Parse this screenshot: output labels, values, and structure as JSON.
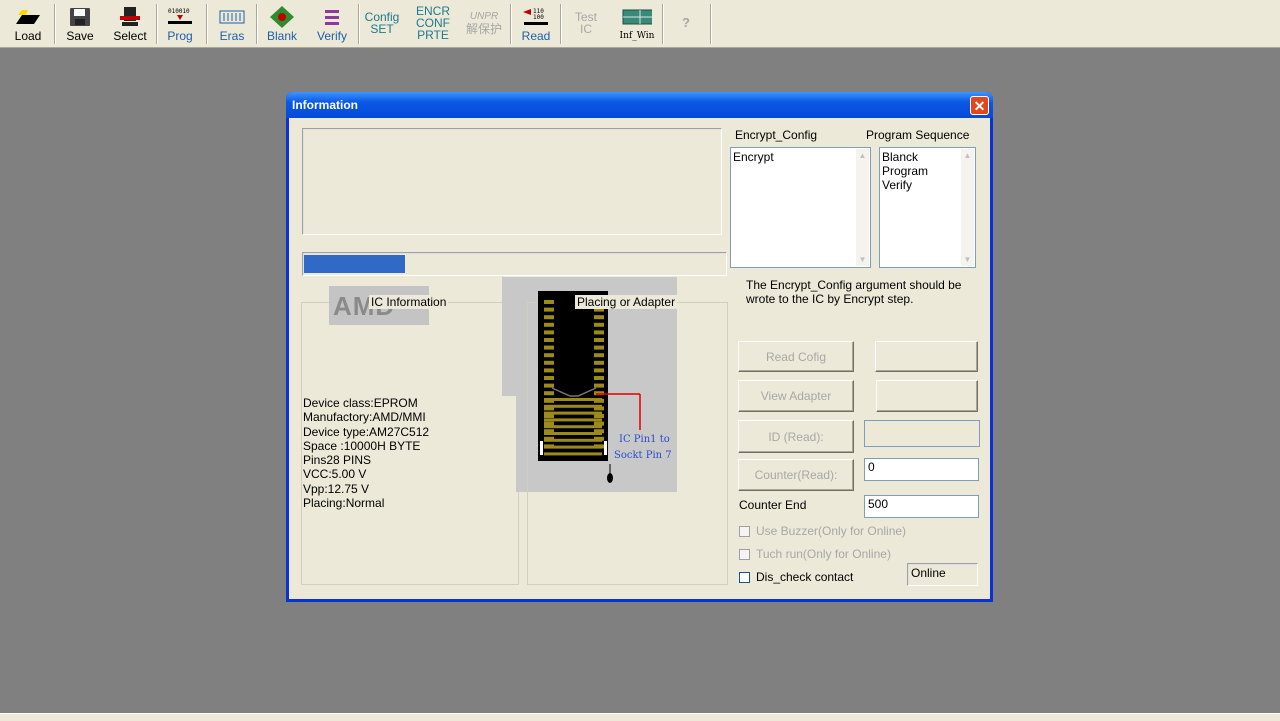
{
  "toolbar": {
    "load": "Load",
    "save": "Save",
    "select": "Select",
    "prog": "Prog",
    "eras": "Eras",
    "blank": "Blank",
    "verify": "Verify",
    "config_line1": "Config",
    "config_line2": "SET",
    "encr_line1": "ENCR",
    "encr_line2": "CONF",
    "encr_line3": "PRTE",
    "unpr_line1": "UNPR",
    "unpr_line2": "解保护",
    "read": "Read",
    "test_line1": "Test",
    "test_line2": "IC",
    "inf_win": "Inf_Win",
    "help": "?"
  },
  "dialog": {
    "title": "Information",
    "close": "✕",
    "progress": 0.24,
    "encrypt_config_label": "Encrypt_Config",
    "encrypt_config_items": [
      "Encrypt"
    ],
    "program_sequence_label": "Program Sequence",
    "program_sequence_items": [
      "Blanck",
      "Program",
      "Verify"
    ],
    "note_line1": "The Encrypt_Config argument should be",
    "note_line2": "wrote to the IC by Encrypt step.",
    "ic_info_label": "IC Information",
    "placing_label": "Placing or Adapter",
    "logo_text": "AMD",
    "pin_note_line1": "IC Pin1 to",
    "pin_note_line2": "Sockt Pin 7",
    "device_class": "Device class:EPROM",
    "manufactory": "Manufactory:AMD/MMI",
    "device_type": "Device type:AM27C512",
    "space": "Space :10000H  BYTE",
    "pins": "Pins28   PINS",
    "vcc": "VCC:5.00   V",
    "vpp": "Vpp:12.75   V",
    "placing": "Placing:Normal",
    "read_config": "Read Cofig",
    "view_adapter": "View Adapter",
    "id_read": "ID (Read):",
    "counter_read": "Counter(Read):",
    "counter_value": "0",
    "counter_end_label": "Counter End",
    "counter_end_value": "500",
    "use_buzzer": "Use Buzzer(Only for Online)",
    "tuch_run": "Tuch run(Only for Online)",
    "dis_check": "Dis_check contact",
    "online": "Online"
  },
  "colors": {
    "progress_fill": "#3169c6",
    "title_bar": "#0a58e4",
    "chip_pin_gold": "#9c8a1a",
    "pin_line_red": "#e00000",
    "pin_note_blue": "#2a4bd0"
  }
}
